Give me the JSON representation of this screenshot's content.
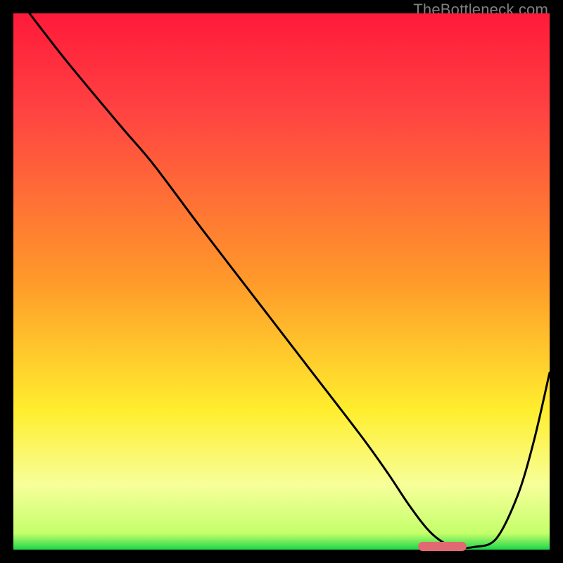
{
  "watermark": "TheBottleneck.com",
  "colors": {
    "top": "#ff1a3a",
    "mid_red": "#ff4242",
    "orange": "#ff9a2a",
    "yellow": "#ffee2e",
    "pale": "#f7ff9a",
    "green": "#1cd64a",
    "curve": "#000000",
    "marker": "#e16971",
    "frame": "#000000",
    "wm": "#808080"
  },
  "chart_data": {
    "type": "line",
    "title": "",
    "xlabel": "",
    "ylabel": "",
    "xlim": [
      0,
      100
    ],
    "ylim": [
      0,
      100
    ],
    "x": [
      3,
      10,
      20,
      26,
      35,
      45,
      55,
      65,
      70,
      74,
      78,
      82,
      86,
      90,
      94,
      97,
      100
    ],
    "values": [
      100,
      91,
      79,
      72,
      60,
      47,
      34,
      21,
      14,
      8,
      3,
      0.5,
      0.5,
      2,
      10,
      20,
      33
    ],
    "optimal_range_x": [
      75.5,
      84.5
    ],
    "gradient_stops": [
      {
        "pos": 0,
        "c": "#ff1a3a"
      },
      {
        "pos": 18,
        "c": "#ff4242"
      },
      {
        "pos": 50,
        "c": "#ff9a2a"
      },
      {
        "pos": 74,
        "c": "#ffee2e"
      },
      {
        "pos": 88,
        "c": "#f7ff9a"
      },
      {
        "pos": 97,
        "c": "#c4ff6a"
      },
      {
        "pos": 100,
        "c": "#1cd64a"
      }
    ]
  }
}
